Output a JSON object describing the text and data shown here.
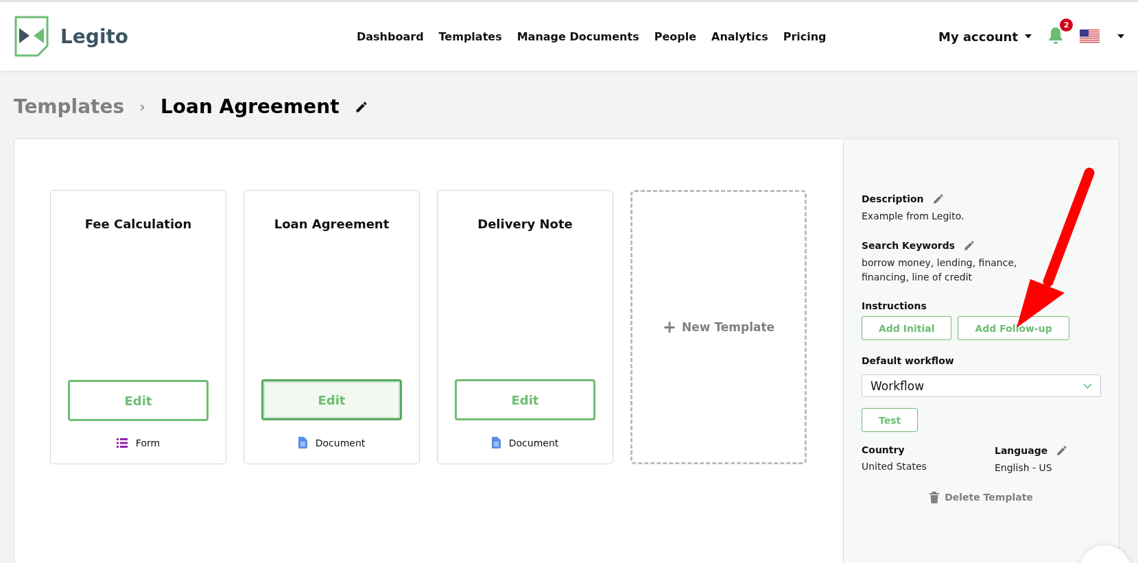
{
  "header": {
    "logo_text": "Legito",
    "nav": [
      "Dashboard",
      "Templates",
      "Manage Documents",
      "People",
      "Analytics",
      "Pricing"
    ],
    "account": "My account",
    "notifications": "2"
  },
  "breadcrumb": {
    "parent": "Templates",
    "separator": "›",
    "current": "Loan Agreement"
  },
  "cards": [
    {
      "title": "Fee Calculation",
      "button": "Edit",
      "focused": false,
      "kind": "form",
      "type_label": "Form"
    },
    {
      "title": "Loan Agreement",
      "button": "Edit",
      "focused": true,
      "kind": "document",
      "type_label": "Document"
    },
    {
      "title": "Delivery Note",
      "button": "Edit",
      "focused": false,
      "kind": "document",
      "type_label": "Document"
    }
  ],
  "new_template": {
    "icon": "+",
    "label": "New Template"
  },
  "details": {
    "description_label": "Description",
    "description": "Example from Legito.",
    "keywords_label": "Search Keywords",
    "keywords": "borrow money, lending, finance, financing, line of credit",
    "instructions_label": "Instructions",
    "instruction_buttons": [
      "Add Initial",
      "Add Follow-up"
    ],
    "workflow_label": "Default workflow",
    "workflow": "Workflow",
    "test_button": "Test",
    "country_label": "Country",
    "country": "United States",
    "language_label": "Language",
    "language": "English - US",
    "delete": "Delete Template"
  }
}
